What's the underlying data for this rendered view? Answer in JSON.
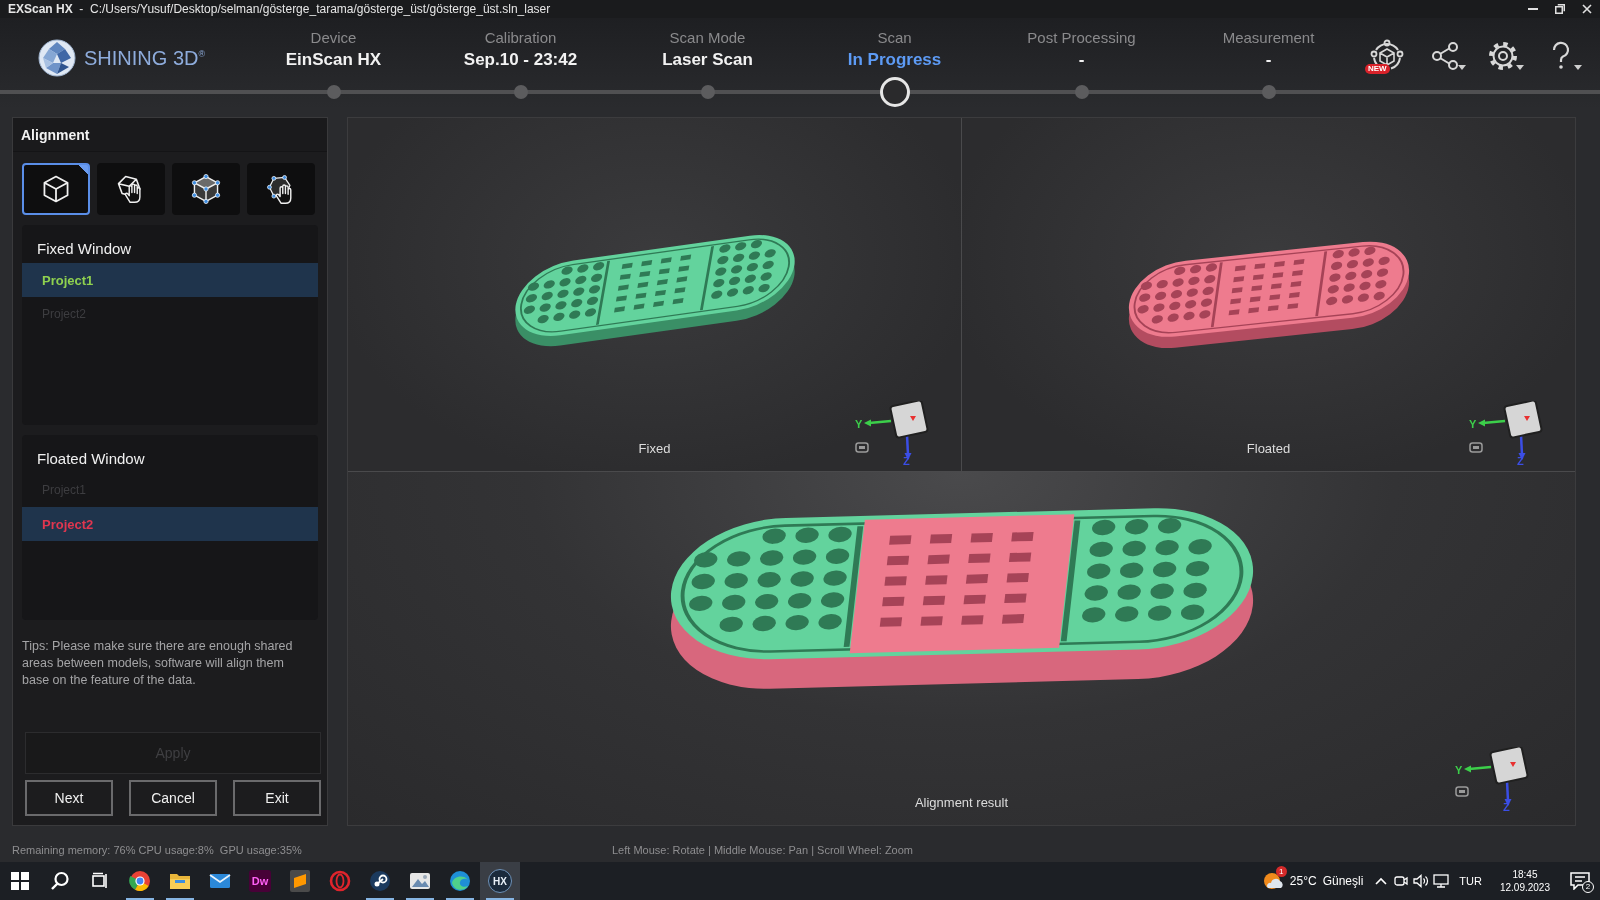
{
  "window": {
    "title": "**EXScan HX**  -  C:/Users/Yusuf/Desktop/selman/gösterge_tarama/gösterge_üst/gösterge_üst.sln_laser",
    "controls": [
      {
        "kind": "minimize"
      },
      {
        "kind": "restore"
      },
      {
        "kind": "close"
      }
    ]
  },
  "logo": {
    "text": "SHINING 3D$^{®}$"
  },
  "steps": [
    {
      "label": "Device",
      "value": "EinScan HX",
      "selected": false
    },
    {
      "label": "Calibration",
      "value": "Sep.10 - 23:42",
      "selected": false
    },
    {
      "label": "Scan Mode",
      "value": "Laser Scan",
      "selected": false
    },
    {
      "label": "Scan",
      "value": "In Progress",
      "selected": true
    },
    {
      "label": "Post Processing",
      "value": "-",
      "selected": false
    },
    {
      "label": "Measurement",
      "value": "-",
      "selected": false
    }
  ],
  "header_tools": [
    {
      "kind": "cycle",
      "badge": "NEW",
      "dropdown": false
    },
    {
      "kind": "share",
      "dropdown": true
    },
    {
      "kind": "settings",
      "dropdown": true
    },
    {
      "kind": "help",
      "dropdown": true
    }
  ],
  "alignment": {
    "title": "Alignment",
    "tools": [
      {
        "kind": "cube",
        "selected": true
      },
      {
        "kind": "cube_hand",
        "selected": false
      },
      {
        "kind": "cube_points",
        "selected": false
      },
      {
        "kind": "hand_points",
        "selected": false
      }
    ],
    "windows": [
      {
        "title": "Fixed Window",
        "color": "#8fd14f",
        "items": [
          {
            "label": "Project1",
            "selected": true
          },
          {
            "label": "Project2",
            "selected": false
          }
        ]
      },
      {
        "title": "Floated Window",
        "color": "#e0364f",
        "items": [
          {
            "label": "Project1",
            "selected": false
          },
          {
            "label": "Project2",
            "selected": true
          }
        ]
      }
    ],
    "tips": "Tips: Please make sure there are enough shared areas between models, software will align them base on the feature of the data.",
    "apply": {
      "label": "Apply",
      "disabled": true
    },
    "buttons": [
      "Next",
      "Cancel",
      "Exit"
    ]
  },
  "viewports": [
    {
      "kind": "fixed",
      "label": "Fixed",
      "axes": [
        "Y",
        "Z"
      ]
    },
    {
      "kind": "floated",
      "label": "Floated",
      "axes": [
        "Y",
        "Z"
      ]
    },
    {
      "kind": "result",
      "label": "Alignment result",
      "axes": [
        "Y",
        "Z"
      ]
    }
  ],
  "status_bar": {
    "stats": "Remaining memory: 76% CPU usage:8%  GPU usage:35%",
    "hint": "Left Mouse: Rotate | Middle Mouse: Pan | Scroll Wheel: Zoom"
  },
  "taskbar": {
    "pinned": [
      {
        "kind": "start"
      },
      {
        "kind": "search"
      },
      {
        "kind": "task_view"
      }
    ],
    "apps": [
      {
        "kind": "browser",
        "running": true,
        "selected": false
      },
      {
        "kind": "folder",
        "running": true,
        "selected": false
      },
      {
        "kind": "mail",
        "running": false,
        "selected": false
      },
      {
        "kind": "tile",
        "label": "Dw",
        "running": false,
        "selected": false
      },
      {
        "kind": "editor",
        "running": false,
        "selected": false
      },
      {
        "kind": "ring",
        "running": false,
        "selected": false
      },
      {
        "kind": "disc",
        "running": true,
        "selected": false
      },
      {
        "kind": "photo",
        "running": true,
        "selected": false
      },
      {
        "kind": "wave",
        "running": true,
        "selected": false
      },
      {
        "kind": "badge",
        "label": "HX",
        "running": true,
        "selected": true
      }
    ],
    "tray": {
      "weather": {
        "badge": "1",
        "temperature": "25°C",
        "condition": "Güneşli"
      },
      "icons": [
        {
          "kind": "chevron"
        },
        {
          "kind": "camera"
        },
        {
          "kind": "volume"
        },
        {
          "kind": "network"
        }
      ],
      "language": "TUR",
      "time": "18:45",
      "date": "12.09.2023",
      "notifications": "2"
    }
  }
}
